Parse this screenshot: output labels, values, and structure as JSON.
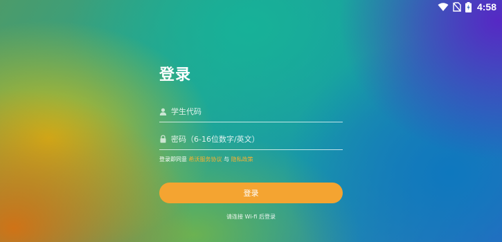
{
  "status_bar": {
    "time": "4:58",
    "icons": [
      "wifi-icon",
      "no-sim-icon",
      "battery-charging-icon"
    ]
  },
  "login": {
    "title": "登录",
    "username_placeholder": "学生代码",
    "password_placeholder": "密码（6-16位数字/英文）",
    "agreement_prefix": "登录即同意",
    "terms_link": "希沃服务协议",
    "agreement_conjunction": "与",
    "privacy_link": "隐私政策",
    "button_label": "登录",
    "wifi_hint": "请连接 Wi-fi 后登录"
  },
  "colors": {
    "accent": "#f4a431",
    "link": "#f6b132"
  }
}
